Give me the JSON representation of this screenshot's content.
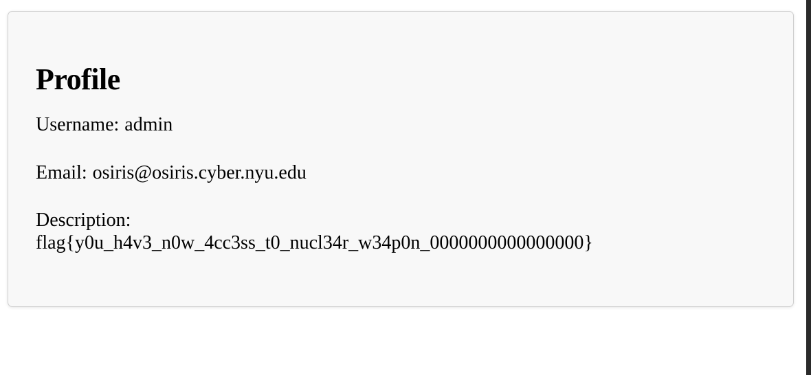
{
  "profile": {
    "title": "Profile",
    "username_label": "Username:",
    "username": "admin",
    "email_label": "Email:",
    "email": "osiris@osiris.cyber.nyu.edu",
    "description_label": "Description:",
    "description": "flag{y0u_h4v3_n0w_4cc3ss_t0_nucl34r_w34p0n_0000000000000000}"
  }
}
